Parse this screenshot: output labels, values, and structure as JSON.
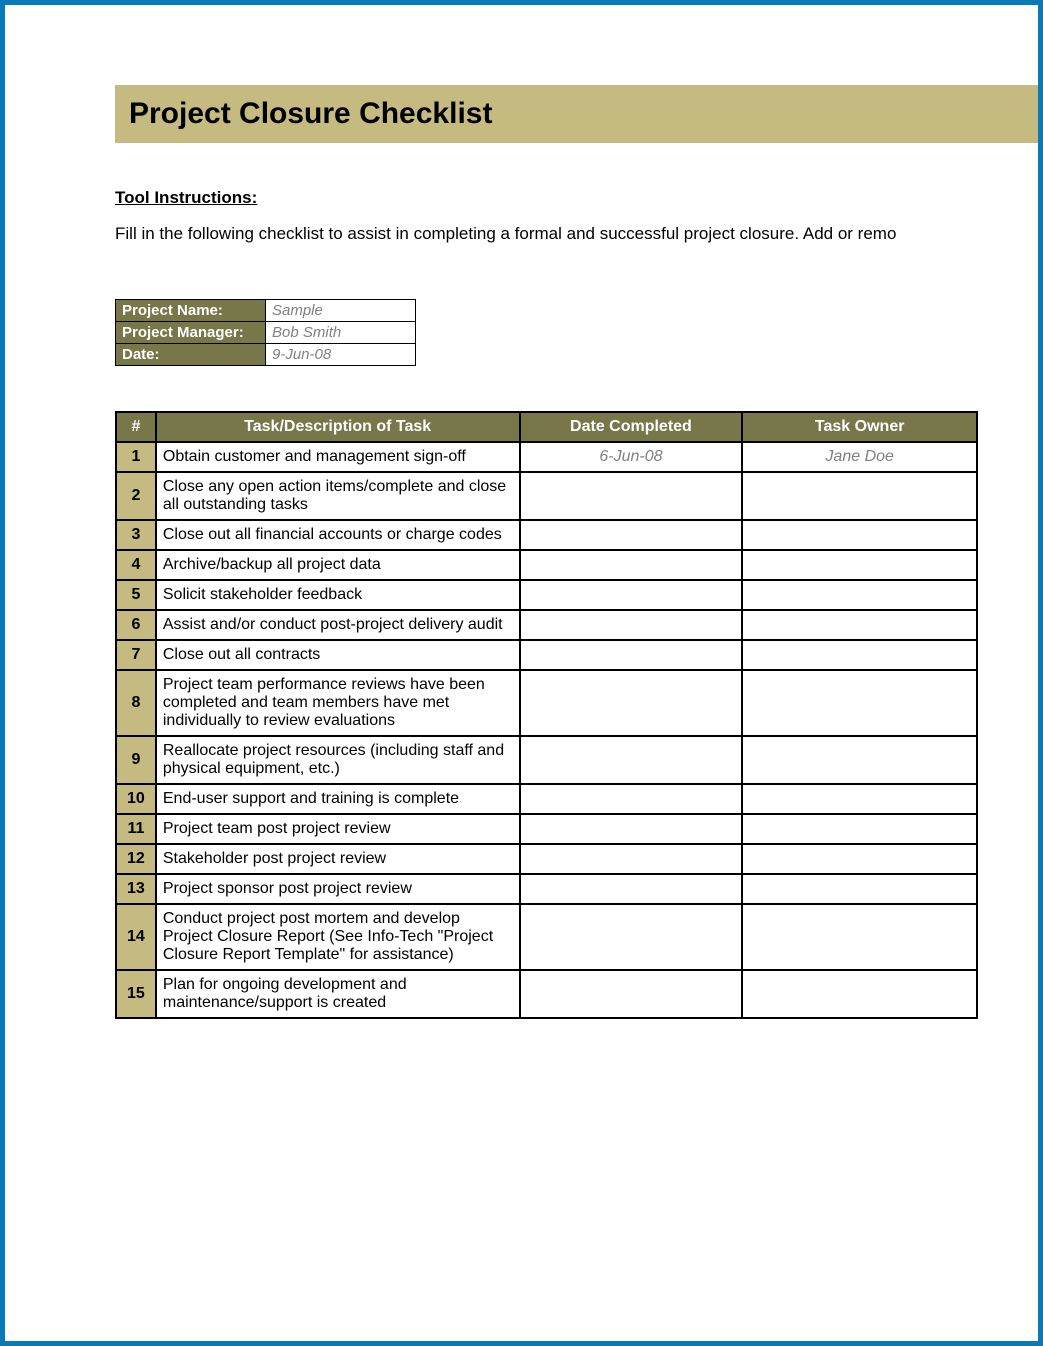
{
  "title": "Project Closure Checklist",
  "instructions_heading": "Tool Instructions:",
  "instructions_text": "Fill in the following checklist to assist in completing a formal and successful project closure. Add or remo",
  "info": {
    "project_name_label": "Project Name:",
    "project_name_value": "Sample",
    "project_manager_label": "Project Manager:",
    "project_manager_value": "Bob Smith",
    "date_label": "Date:",
    "date_value": "9-Jun-08"
  },
  "checklist_headers": {
    "num": "#",
    "task": "Task/Description of Task",
    "date": "Date Completed",
    "owner": "Task Owner"
  },
  "rows": [
    {
      "num": "1",
      "task": "Obtain customer and management sign-off",
      "date": "6-Jun-08",
      "owner": "Jane Doe"
    },
    {
      "num": "2",
      "task": "Close any open action items/complete and close all outstanding tasks",
      "date": "",
      "owner": ""
    },
    {
      "num": "3",
      "task": "Close out all financial accounts or charge codes",
      "date": "",
      "owner": ""
    },
    {
      "num": "4",
      "task": "Archive/backup all project data",
      "date": "",
      "owner": ""
    },
    {
      "num": "5",
      "task": "Solicit stakeholder feedback",
      "date": "",
      "owner": ""
    },
    {
      "num": "6",
      "task": "Assist and/or conduct post-project delivery audit",
      "date": "",
      "owner": ""
    },
    {
      "num": "7",
      "task": "Close out all contracts",
      "date": "",
      "owner": ""
    },
    {
      "num": "8",
      "task": "Project team performance reviews have been completed and team members have met individually to review evaluations",
      "date": "",
      "owner": ""
    },
    {
      "num": "9",
      "task": "Reallocate project resources (including staff and physical equipment, etc.)",
      "date": "",
      "owner": ""
    },
    {
      "num": "10",
      "task": "End-user support and training is complete",
      "date": "",
      "owner": ""
    },
    {
      "num": "11",
      "task": "Project team post project review",
      "date": "",
      "owner": ""
    },
    {
      "num": "12",
      "task": "Stakeholder post project review",
      "date": "",
      "owner": ""
    },
    {
      "num": "13",
      "task": "Project sponsor post project review",
      "date": "",
      "owner": ""
    },
    {
      "num": "14",
      "task": "Conduct project post mortem and develop Project Closure Report (See Info-Tech \"Project Closure Report Template\" for assistance)",
      "date": "",
      "owner": ""
    },
    {
      "num": "15",
      "task": "Plan for ongoing development and maintenance/support is created",
      "date": "",
      "owner": ""
    }
  ]
}
